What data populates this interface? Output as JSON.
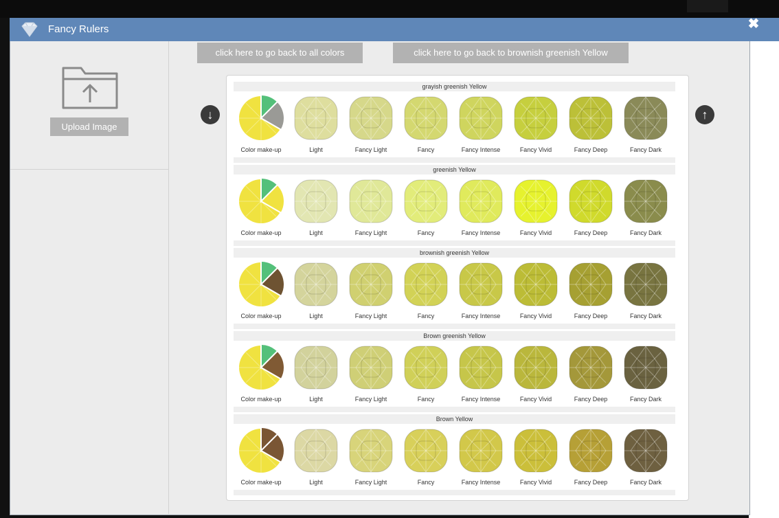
{
  "window": {
    "title": "Fancy Rulers"
  },
  "sidebar": {
    "upload_label": "Upload Image"
  },
  "nav": {
    "back_all": "click here to go back to all colors",
    "back_family": "click here to go back to brownish greenish Yellow"
  },
  "grades": [
    "Color make-up",
    "Light",
    "Fancy Light",
    "Fancy",
    "Fancy Intense",
    "Fancy Vivid",
    "Fancy Deep",
    "Fancy Dark"
  ],
  "rulers": [
    {
      "name": "grayish greenish Yellow",
      "makeup": [
        "#f0e240",
        "#9a9a96",
        "#54c07a"
      ],
      "grades": [
        "#dede9e",
        "#d6d88a",
        "#d4d870",
        "#cfd55e",
        "#c6cf3e",
        "#bcc038",
        "#8a8a58"
      ]
    },
    {
      "name": "greenish Yellow",
      "makeup": [
        "#f0e240",
        "#f0e240",
        "#54c07a"
      ],
      "grades": [
        "#e2e6b2",
        "#e0e898",
        "#e2ec7a",
        "#e0ea5c",
        "#e6f22e",
        "#d0da2c",
        "#8a8c4c"
      ]
    },
    {
      "name": "brownish greenish Yellow",
      "makeup": [
        "#f0e240",
        "#6e5332",
        "#54c07a"
      ],
      "grades": [
        "#d4d49c",
        "#d0d070",
        "#d2d256",
        "#c8c848",
        "#bcbc36",
        "#a6a032",
        "#787440"
      ]
    },
    {
      "name": "Brown greenish Yellow",
      "makeup": [
        "#f0e240",
        "#805a34",
        "#54c07a"
      ],
      "grades": [
        "#d2d29c",
        "#cfcf76",
        "#d0d058",
        "#c6c64a",
        "#bab73c",
        "#a4983a",
        "#6a6240"
      ]
    },
    {
      "name": "Brown Yellow",
      "makeup": [
        "#f0e240",
        "#7a5634",
        "#7a5634"
      ],
      "grades": [
        "#dcd8a4",
        "#d8d47a",
        "#d8d05a",
        "#d2c84a",
        "#cbbf3a",
        "#b6a036",
        "#6e6040"
      ]
    }
  ],
  "colors": {
    "titlebar": "#5f87b8",
    "button": "#b2b2b2",
    "arrow": "#3a3a3a"
  },
  "icons": {
    "logo": "diamond-icon",
    "close": "close-icon",
    "upload": "folder-upload-icon",
    "scroll_down": "arrow-down-icon",
    "scroll_up": "arrow-up-icon"
  }
}
